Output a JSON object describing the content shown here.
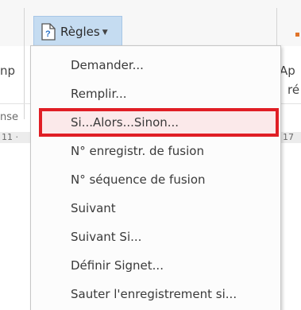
{
  "ribbon": {
    "rules_button": {
      "label": "Règles",
      "icon": "document-rules-icon",
      "dropdown_icon": "chevron-down-icon"
    },
    "left_fragment_1": "np",
    "left_fragment_2": "nse",
    "left_fragment_3": "11 ·",
    "right_fragment_1": "Ap",
    "right_fragment_2": "ré",
    "right_fragment_3": "17",
    "accent_color": "#e0742a"
  },
  "menu": {
    "items": [
      {
        "label": "Demander..."
      },
      {
        "label": "Remplir..."
      },
      {
        "label": "Si...Alors...Sinon..."
      },
      {
        "label": "N° enregistr. de fusion"
      },
      {
        "label": "N° séquence de fusion"
      },
      {
        "label": "Suivant"
      },
      {
        "label": "Suivant Si..."
      },
      {
        "label": "Définir Signet..."
      },
      {
        "label": "Sauter l'enregistrement si..."
      }
    ],
    "highlight_color": "#e01e25"
  }
}
